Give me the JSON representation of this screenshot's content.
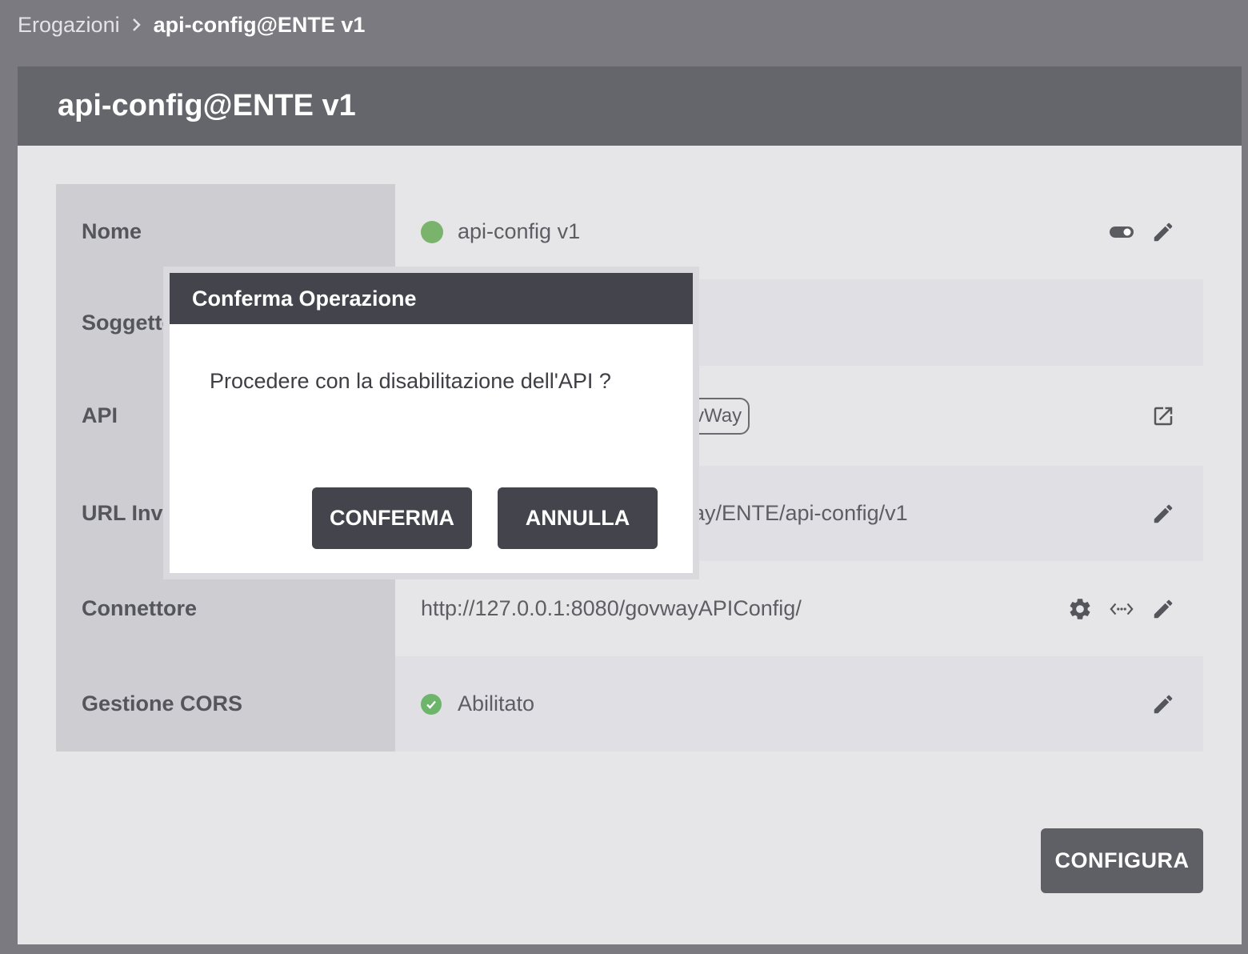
{
  "breadcrumb": {
    "parent": "Erogazioni",
    "current": "api-config@ENTE v1"
  },
  "panel": {
    "title": "api-config@ENTE v1"
  },
  "properties": [
    {
      "label": "Nome",
      "value": "api-config v1"
    },
    {
      "label": "Soggetto",
      "value": ""
    },
    {
      "label": "API",
      "value": "",
      "badge": "GovWay"
    },
    {
      "label": "URL Invocazione",
      "value": "ay/ENTE/api-config/v1"
    },
    {
      "label": "Connettore",
      "value": "http://127.0.0.1:8080/govwayAPIConfig/"
    },
    {
      "label": "Gestione CORS",
      "value": "Abilitato"
    }
  ],
  "configura_label": "CONFIGURA",
  "modal": {
    "title": "Conferma Operazione",
    "message": "Procedere con la disabilitazione dell'API ?",
    "confirm_label": "CONFERMA",
    "cancel_label": "ANNULLA"
  },
  "colors": {
    "status_active": "#7ab36b",
    "header_bg": "#65656c",
    "modal_header_bg": "#44444c"
  }
}
